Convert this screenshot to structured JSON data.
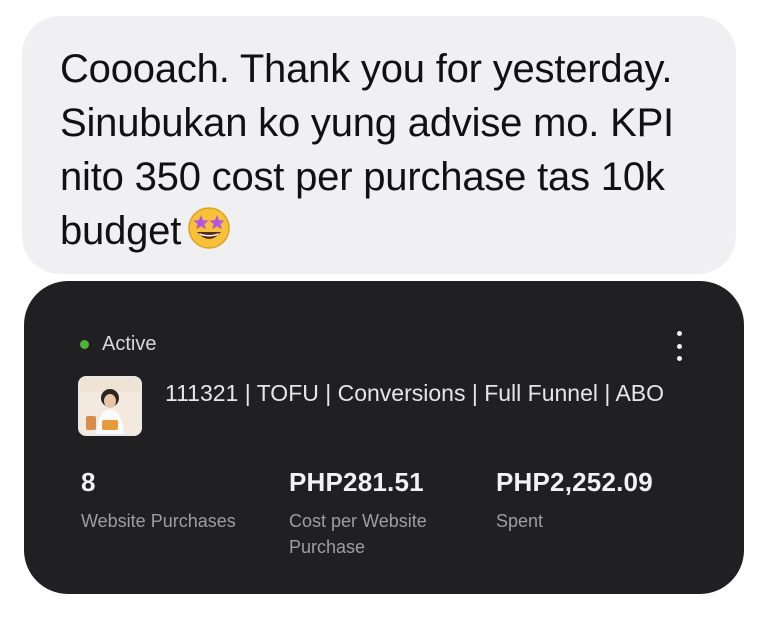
{
  "message": {
    "text": "Coooach. Thank you for yesterday. Sinubukan ko yung advise mo. KPI nito 350 cost per purchase tas 10k budget",
    "emoji": "star-struck-emoji"
  },
  "ad_card": {
    "status": "Active",
    "status_color": "#4fb33a",
    "more_icon": "more-vertical-icon",
    "campaign_name": "111321 | TOFU | Conversions | Full Funnel | ABO",
    "metrics": [
      {
        "value": "8",
        "label": "Website Purchases"
      },
      {
        "value": "PHP281.51",
        "label": "Cost per Website Purchase"
      },
      {
        "value": "PHP2,252.09",
        "label": "Spent"
      }
    ]
  }
}
